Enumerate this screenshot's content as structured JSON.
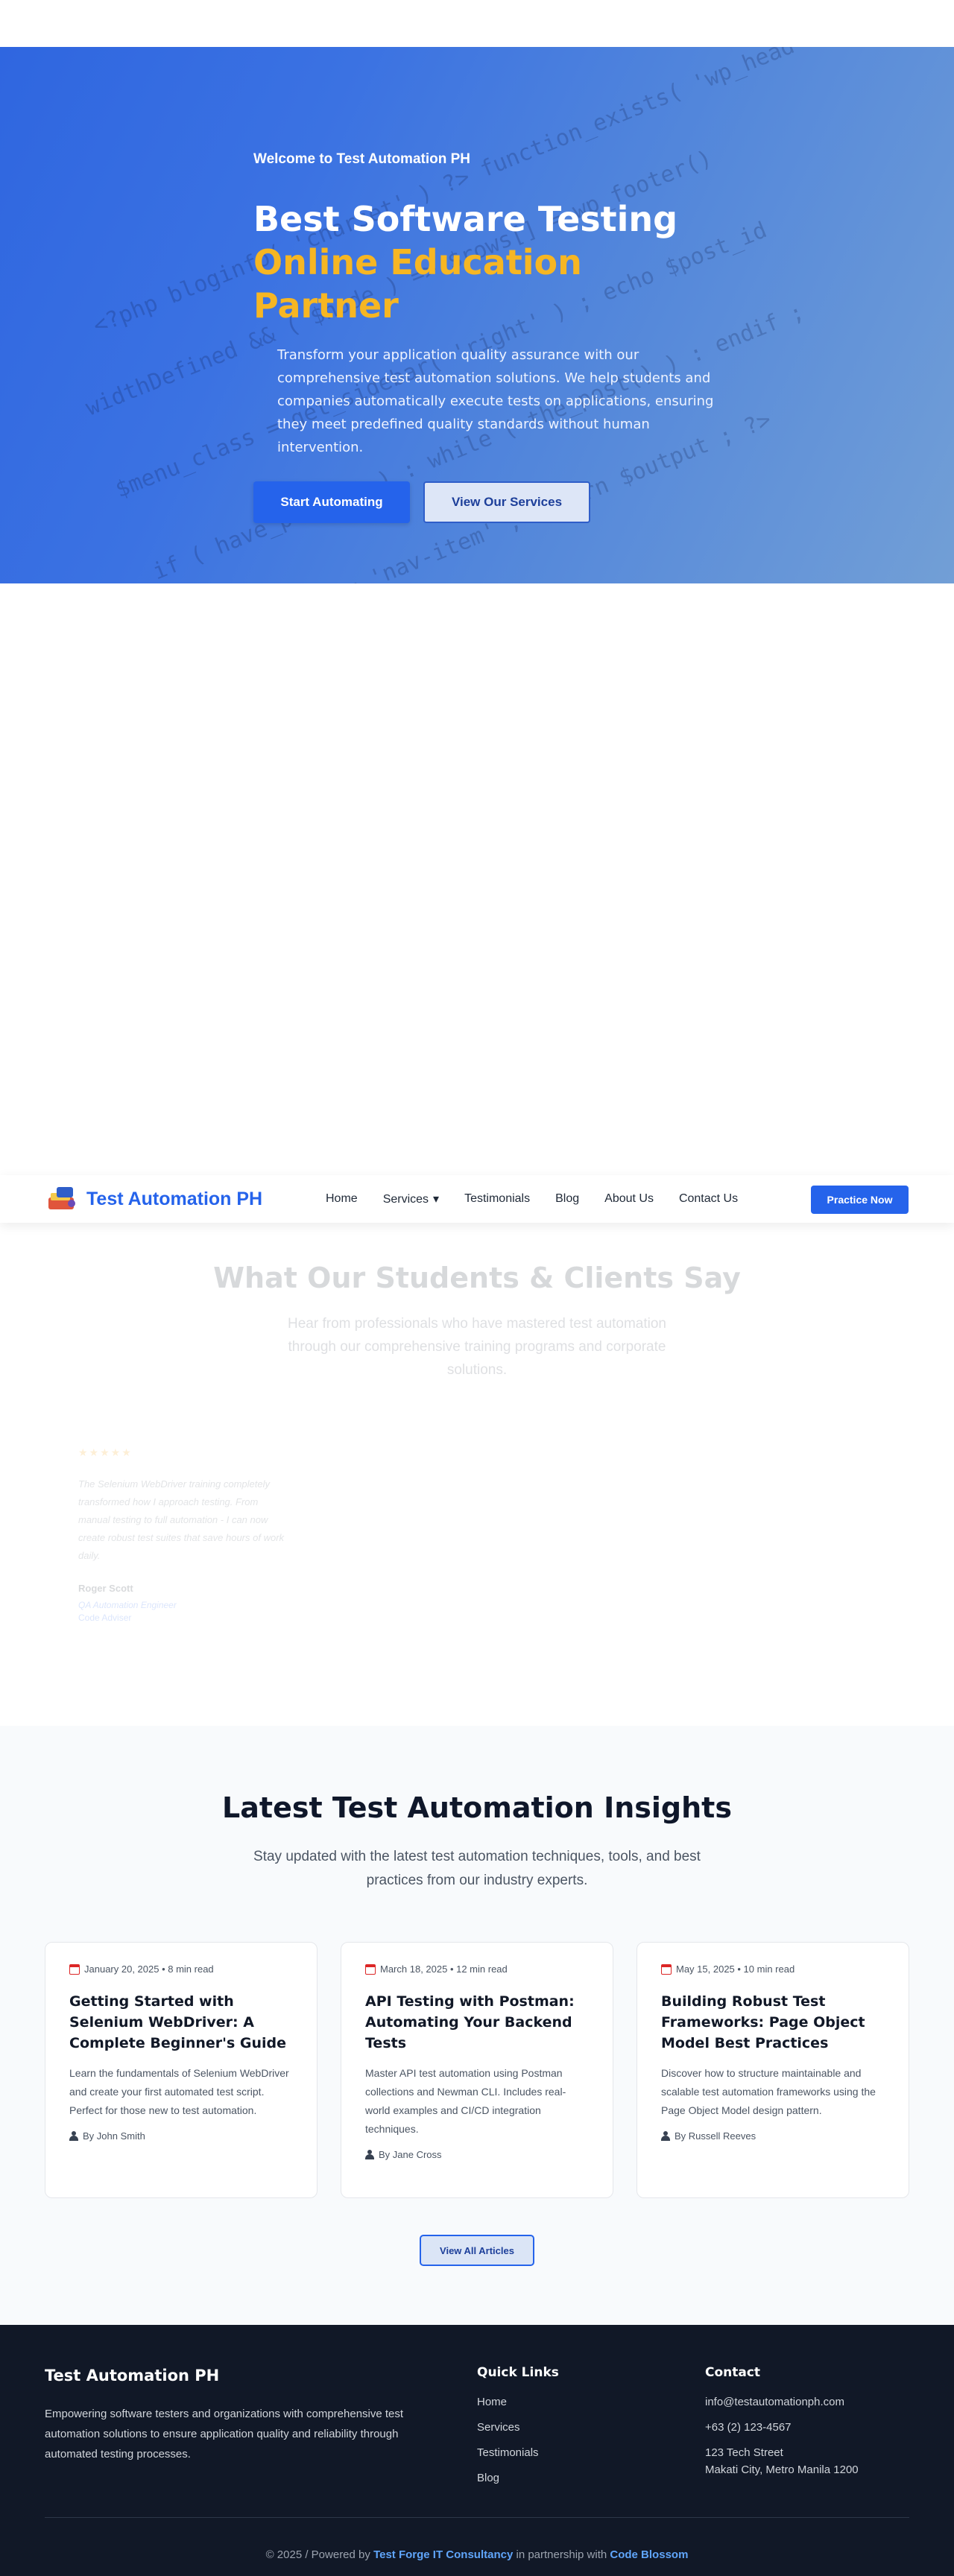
{
  "hero": {
    "welcome": "Welcome to Test Automation PH",
    "title_line1": "Best Software Testing",
    "title_line2": "Online Education Partner",
    "description": "Transform your application quality assurance with our comprehensive test automation solutions. We help students and companies automatically execute tests on applications, ensuring they meet predefined quality standards without human intervention.",
    "primary_button": "Start Automating",
    "secondary_button": "View Our Services",
    "accent_color": "#f6b623"
  },
  "nav": {
    "brand": "Test Automation PH",
    "links": [
      "Home",
      "Services",
      "Testimonials",
      "Blog",
      "About Us",
      "Contact Us"
    ],
    "services_caret": "▾",
    "cta": "Practice Now",
    "brand_color": "#2563eb"
  },
  "testimonials": {
    "title": "What Our Students & Clients Say",
    "subtitle": "Hear from professionals who have mastered test automation through our comprehensive training programs and corporate solutions.",
    "items": [
      {
        "stars": "★★★★★",
        "quote": "The Selenium WebDriver training completely transformed how I approach testing. From manual testing to full automation - I can now create robust test suites that save hours of work daily.",
        "author": "Roger Scott",
        "role": "QA Automation Engineer",
        "company": "Code Adviser"
      }
    ]
  },
  "insights": {
    "title": "Latest Test Automation Insights",
    "subtitle": "Stay updated with the latest test automation techniques, tools, and best practices from our industry experts.",
    "articles": [
      {
        "meta": "January 20, 2025 • 8 min read",
        "title": "Getting Started with Selenium WebDriver: A Complete Beginner's Guide",
        "excerpt": "Learn the fundamentals of Selenium WebDriver and create your first automated test script. Perfect for those new to test automation.",
        "author": "By John Smith"
      },
      {
        "meta": "March 18, 2025 • 12 min read",
        "title": "API Testing with Postman: Automating Your Backend Tests",
        "excerpt": "Master API test automation using Postman collections and Newman CLI. Includes real-world examples and CI/CD integration techniques.",
        "author": "By Jane Cross"
      },
      {
        "meta": "May 15, 2025 • 10 min read",
        "title": "Building Robust Test Frameworks: Page Object Model Best Practices",
        "excerpt": "Discover how to structure maintainable and scalable test automation frameworks using the Page Object Model design pattern.",
        "author": "By Russell Reeves"
      }
    ],
    "view_all": "View All Articles"
  },
  "footer": {
    "brand": "Test Automation PH",
    "description": "Empowering software testers and organizations with comprehensive test automation solutions to ensure application quality and reliability through automated testing processes.",
    "quick_links_title": "Quick Links",
    "quick_links": [
      "Home",
      "Services",
      "Testimonials",
      "Blog"
    ],
    "contact_title": "Contact",
    "contact": {
      "email": "info@testautomationph.com",
      "phone": "+63 (2) 123-4567",
      "address_line1": "123 Tech Street",
      "address_line2": "Makati City, Metro Manila 1200"
    },
    "copyright_prefix": "© 2025 / Powered by ",
    "powered_by": "Test Forge IT Consultancy",
    "partnership_text": " in partnership with ",
    "partner": "Code Blossom"
  }
}
